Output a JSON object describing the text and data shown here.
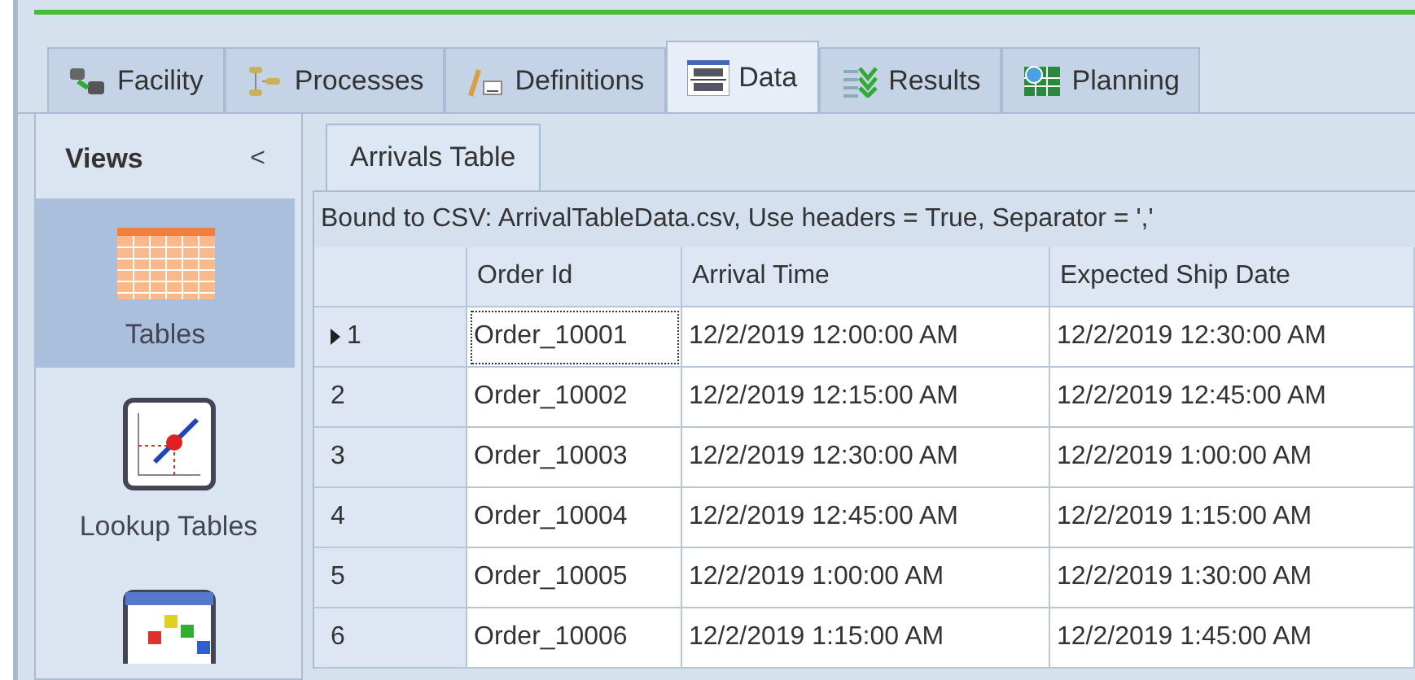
{
  "tabs": [
    {
      "label": "Facility",
      "selected": false
    },
    {
      "label": "Processes",
      "selected": false
    },
    {
      "label": "Definitions",
      "selected": false
    },
    {
      "label": "Data",
      "selected": true
    },
    {
      "label": "Results",
      "selected": false
    },
    {
      "label": "Planning",
      "selected": false
    }
  ],
  "sidebar": {
    "title": "Views",
    "collapse": "<",
    "items": [
      {
        "label": "Tables",
        "selected": true
      },
      {
        "label": "Lookup Tables",
        "selected": false
      }
    ]
  },
  "document_tabs": [
    {
      "label": "Arrivals Table",
      "selected": true
    }
  ],
  "binding": "Bound to CSV: ArrivalTableData.csv, Use headers = True, Separator = ','",
  "table": {
    "columns": [
      "Order Id",
      "Arrival Time",
      "Expected Ship Date"
    ],
    "rows": [
      {
        "number": "1",
        "current": true,
        "cells": [
          "Order_10001",
          "12/2/2019 12:00:00 AM",
          "12/2/2019 12:30:00 AM"
        ]
      },
      {
        "number": "2",
        "current": false,
        "cells": [
          "Order_10002",
          "12/2/2019 12:15:00 AM",
          "12/2/2019 12:45:00 AM"
        ]
      },
      {
        "number": "3",
        "current": false,
        "cells": [
          "Order_10003",
          "12/2/2019 12:30:00 AM",
          "12/2/2019 1:00:00 AM"
        ]
      },
      {
        "number": "4",
        "current": false,
        "cells": [
          "Order_10004",
          "12/2/2019 12:45:00 AM",
          "12/2/2019 1:15:00 AM"
        ]
      },
      {
        "number": "5",
        "current": false,
        "cells": [
          "Order_10005",
          "12/2/2019 1:00:00 AM",
          "12/2/2019 1:30:00 AM"
        ]
      },
      {
        "number": "6",
        "current": false,
        "cells": [
          "Order_10006",
          "12/2/2019 1:15:00 AM",
          "12/2/2019 1:45:00 AM"
        ]
      }
    ]
  }
}
